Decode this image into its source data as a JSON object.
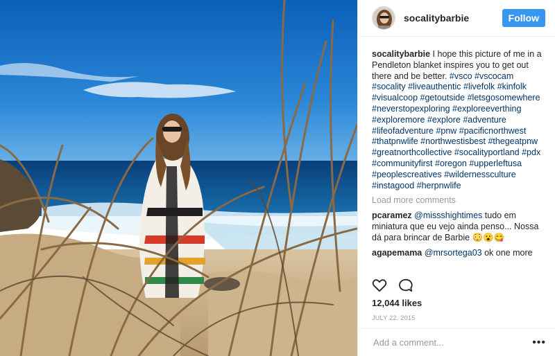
{
  "post": {
    "username": "socalitybarbie",
    "follow_label": "Follow"
  },
  "caption": {
    "username": "socalitybarbie",
    "text": " I hope this picture of me in a Pendleton blanket inspires you to get out there and be better. ",
    "hashtags": "#vsco #vscocam #socality #liveauthentic #livefolk #kinfolk #visualcoop #getoutside #letsgosomewhere #neverstopexploring #exploreeverthing #exploremore #explore #adventure #lifeofadventure #pnw #pacificnorthwest #thatpnwlife #northwestisbest #thegeatpnw #greatnorthcollective #socalityportland #pdx #communityfirst #oregon #upperleftusa #peoplescreatives #wildernessculture #instagood #herpnwlife"
  },
  "load_more": "Load more comments",
  "comments": [
    {
      "user": "pcaramez",
      "mention": "@missshightimes",
      "text": " tudo em miniatura que eu vejo ainda penso... Nossa dá para brincar de Barbie 😳😮😋"
    },
    {
      "user": "agapemama",
      "mention": "@mrsortega03",
      "text": " ok one more"
    }
  ],
  "likes": "12,044 likes",
  "date": "JULY 22, 2015",
  "add_comment_placeholder": "Add a comment...",
  "more_glyph": "•••",
  "icons": [
    "heart-icon",
    "comment-icon",
    "more-options-icon"
  ],
  "colors": {
    "follow_bg": "#3897f0",
    "hashtag": "#003569",
    "muted": "#999999"
  }
}
